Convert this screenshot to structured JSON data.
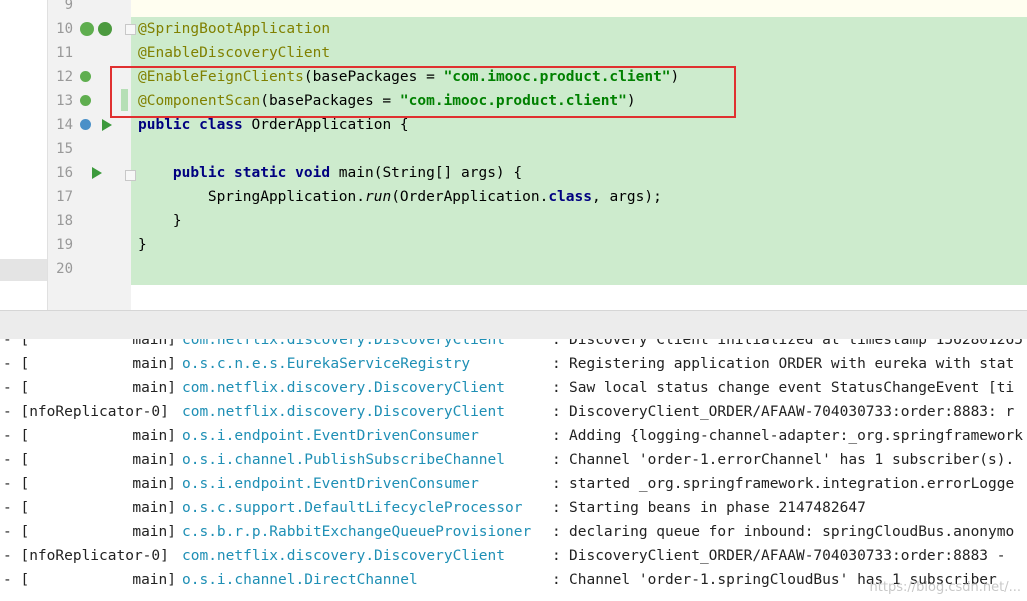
{
  "editor": {
    "line_numbers": [
      "9",
      "10",
      "11",
      "12",
      "13",
      "14",
      "15",
      "16",
      "17",
      "18",
      "19",
      "20"
    ],
    "lines": [
      {
        "parts": [
          {
            "t": "",
            "c": "plain"
          }
        ]
      },
      {
        "parts": [
          {
            "t": "@SpringBootApplication",
            "c": "ann"
          }
        ]
      },
      {
        "parts": [
          {
            "t": "@EnableDiscoveryClient",
            "c": "ann"
          }
        ]
      },
      {
        "parts": [
          {
            "t": "@EnableFeignClients",
            "c": "ann"
          },
          {
            "t": "(basePackages = ",
            "c": "plain"
          },
          {
            "t": "\"com.imooc.product.client\"",
            "c": "str"
          },
          {
            "t": ")",
            "c": "plain"
          }
        ]
      },
      {
        "parts": [
          {
            "t": "@ComponentScan",
            "c": "ann"
          },
          {
            "t": "(basePackages = ",
            "c": "plain"
          },
          {
            "t": "\"com.imooc.product.client\"",
            "c": "str"
          },
          {
            "t": ")",
            "c": "plain"
          }
        ]
      },
      {
        "parts": [
          {
            "t": "public class ",
            "c": "kw"
          },
          {
            "t": "OrderApplication {",
            "c": "plain"
          }
        ]
      },
      {
        "parts": [
          {
            "t": "",
            "c": "plain"
          }
        ]
      },
      {
        "parts": [
          {
            "t": "    ",
            "c": "plain"
          },
          {
            "t": "public static void ",
            "c": "kw"
          },
          {
            "t": "main(String[] args) {",
            "c": "plain"
          }
        ]
      },
      {
        "parts": [
          {
            "t": "        SpringApplication.",
            "c": "plain"
          },
          {
            "t": "run",
            "c": "it"
          },
          {
            "t": "(OrderApplication.",
            "c": "plain"
          },
          {
            "t": "class",
            "c": "kw"
          },
          {
            "t": ", args);",
            "c": "plain"
          }
        ]
      },
      {
        "parts": [
          {
            "t": "    }",
            "c": "plain"
          }
        ]
      },
      {
        "parts": [
          {
            "t": "}",
            "c": "plain"
          }
        ]
      },
      {
        "parts": [
          {
            "t": "",
            "c": "plain"
          }
        ]
      }
    ]
  },
  "console": {
    "rows": [
      {
        "prefix": "- [",
        "thread": "main]",
        "logger": "com.netflix.discovery.DiscoveryClient",
        "msg": "Discovery Client initialized at timestamp 1562801265"
      },
      {
        "prefix": "- [",
        "thread": "main]",
        "logger": "o.s.c.n.e.s.EurekaServiceRegistry",
        "msg": "Registering application ORDER with eureka with stat"
      },
      {
        "prefix": "- [",
        "thread": "main]",
        "logger": "com.netflix.discovery.DiscoveryClient",
        "msg": "Saw local status change event StatusChangeEvent [ti"
      },
      {
        "prefix": "- [nfoReplicator-0]",
        "thread": "",
        "logger": "com.netflix.discovery.DiscoveryClient",
        "msg": "DiscoveryClient_ORDER/AFAAW-704030733:order:8883: r"
      },
      {
        "prefix": "- [",
        "thread": "main]",
        "logger": "o.s.i.endpoint.EventDrivenConsumer",
        "msg": "Adding {logging-channel-adapter:_org.springframework"
      },
      {
        "prefix": "- [",
        "thread": "main]",
        "logger": "o.s.i.channel.PublishSubscribeChannel",
        "msg": "Channel 'order-1.errorChannel' has 1 subscriber(s)."
      },
      {
        "prefix": "- [",
        "thread": "main]",
        "logger": "o.s.i.endpoint.EventDrivenConsumer",
        "msg": "started _org.springframework.integration.errorLogge"
      },
      {
        "prefix": "- [",
        "thread": "main]",
        "logger": "o.s.c.support.DefaultLifecycleProcessor",
        "msg": "Starting beans in phase 2147482647"
      },
      {
        "prefix": "- [",
        "thread": "main]",
        "logger": "c.s.b.r.p.RabbitExchangeQueueProvisioner",
        "msg": "declaring queue for inbound: springCloudBus.anonymo"
      },
      {
        "prefix": "- [nfoReplicator-0]",
        "thread": "",
        "logger": "com.netflix.discovery.DiscoveryClient",
        "msg": "DiscoveryClient_ORDER/AFAAW-704030733:order:8883 -"
      },
      {
        "prefix": "- [",
        "thread": "main]",
        "logger": "o.s.i.channel.DirectChannel",
        "msg": "Channel 'order-1.springCloudBus' has 1 subscriber"
      }
    ],
    "separator": ":"
  },
  "watermark": "https://blog.csdn.net/..."
}
